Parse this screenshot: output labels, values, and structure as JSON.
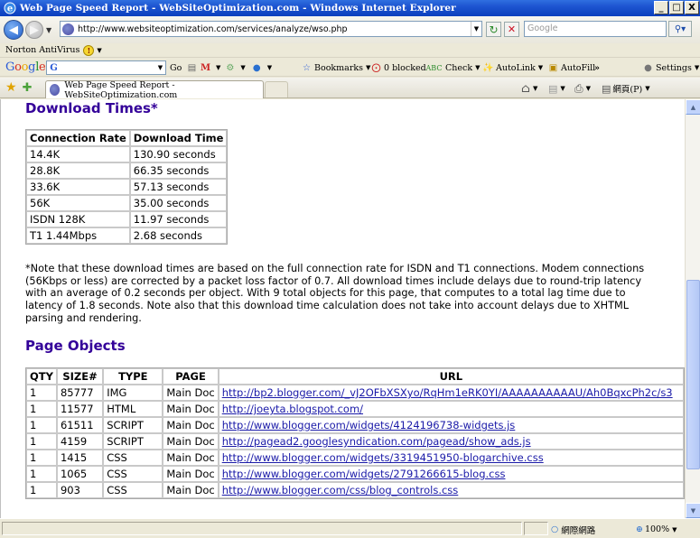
{
  "window": {
    "title": "Web Page Speed Report - WebSiteOptimization.com - Windows Internet Explorer",
    "min_glyph": "_",
    "max_glyph": "□",
    "close_glyph": "X"
  },
  "address_bar": {
    "url": "http://www.websiteoptimization.com/services/analyze/wso.php",
    "search_placeholder": "Google"
  },
  "norton": {
    "label": "Norton AntiVirus"
  },
  "google_toolbar": {
    "logo_letters": [
      "G",
      "o",
      "o",
      "g",
      "l",
      "e"
    ],
    "go_label": "Go",
    "bookmarks_label": "Bookmarks",
    "blocked_label": "0 blocked",
    "check_label": "Check",
    "autolink_label": "AutoLink",
    "autofill_label": "AutoFill",
    "more_label": "»",
    "settings_label": "Settings"
  },
  "tabs": {
    "active_tab_title": "Web Page Speed Report - WebSiteOptimization.com",
    "page_menu_label": "網頁(P)"
  },
  "content": {
    "download_heading": "Download Times*",
    "download_table": {
      "headers": [
        "Connection Rate",
        "Download Time"
      ],
      "rows": [
        [
          "14.4K",
          "130.90 seconds"
        ],
        [
          "28.8K",
          "66.35 seconds"
        ],
        [
          "33.6K",
          "57.13 seconds"
        ],
        [
          "56K",
          "35.00 seconds"
        ],
        [
          "ISDN 128K",
          "11.97 seconds"
        ],
        [
          "T1 1.44Mbps",
          "2.68 seconds"
        ]
      ]
    },
    "note": "*Note that these download times are based on the full connection rate for ISDN and T1 connections. Modem connections (56Kbps or less) are corrected by a packet loss factor of 0.7. All download times include delays due to round-trip latency with an average of 0.2 seconds per object. With 9 total objects for this page, that computes to a total lag time due to latency of 1.8 seconds. Note also that this download time calculation does not take into account delays due to XHTML parsing and rendering.",
    "objects_heading": "Page Objects",
    "objects_table": {
      "headers": [
        "QTY",
        "SIZE#",
        "TYPE",
        "PAGE",
        "URL"
      ],
      "rows": [
        [
          "1",
          "85777",
          "IMG",
          "Main Doc",
          "http://bp2.blogger.com/_vJ2OFbXSXyo/RqHm1eRK0YI/AAAAAAAAAAU/Ah0BqxcPh2c/s3"
        ],
        [
          "1",
          "11577",
          "HTML",
          "Main Doc",
          "http://joeyta.blogspot.com/"
        ],
        [
          "1",
          "61511",
          "SCRIPT",
          "Main Doc",
          "http://www.blogger.com/widgets/4124196738-widgets.js"
        ],
        [
          "1",
          "4159",
          "SCRIPT",
          "Main Doc",
          "http://pagead2.googlesyndication.com/pagead/show_ads.js"
        ],
        [
          "1",
          "1415",
          "CSS",
          "Main Doc",
          "http://www.blogger.com/widgets/3319451950-blogarchive.css"
        ],
        [
          "1",
          "1065",
          "CSS",
          "Main Doc",
          "http://www.blogger.com/widgets/2791266615-blog.css"
        ],
        [
          "1",
          "903",
          "CSS",
          "Main Doc",
          "http://www.blogger.com/css/blog_controls.css"
        ]
      ]
    }
  },
  "status_bar": {
    "zone_label": "網際網路",
    "zoom_label": "100%"
  },
  "colors": {
    "heading": "#330099",
    "titlebar": "#1D54D0",
    "link": "#1a1aa8"
  }
}
